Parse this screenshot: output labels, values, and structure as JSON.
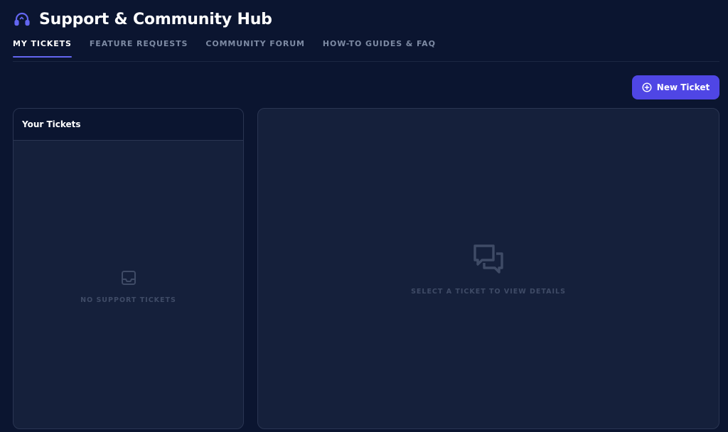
{
  "header": {
    "title": "Support & Community Hub",
    "logo_icon": "headset-icon"
  },
  "tabs": [
    {
      "label": "MY TICKETS",
      "active": true
    },
    {
      "label": "FEATURE REQUESTS",
      "active": false
    },
    {
      "label": "COMMUNITY FORUM",
      "active": false
    },
    {
      "label": "HOW-TO GUIDES & FAQ",
      "active": false
    }
  ],
  "actions": {
    "new_ticket_label": "New Ticket",
    "new_ticket_icon": "plus-circle-icon"
  },
  "tickets_panel": {
    "title": "Your Tickets",
    "empty_icon": "inbox-icon",
    "empty_text": "NO SUPPORT TICKETS"
  },
  "detail_panel": {
    "empty_icon": "chat-bubbles-icon",
    "empty_text": "SELECT A TICKET TO VIEW DETAILS"
  },
  "colors": {
    "background": "#0b1530",
    "panel": "#15203b",
    "accent": "#4f46e5",
    "tab_underline": "#6366f1",
    "muted_text": "#7d8aa3"
  }
}
